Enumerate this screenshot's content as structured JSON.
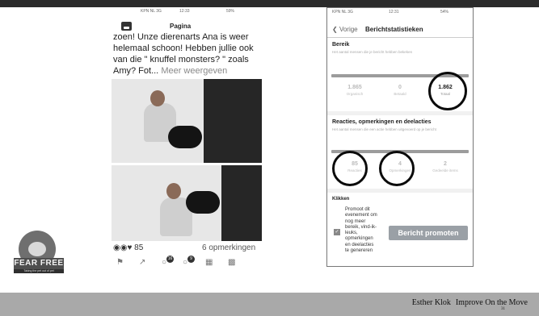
{
  "left_screen": {
    "status": {
      "carrier": "KPN NL 3G",
      "time": "12:33",
      "battery": "59%"
    },
    "page_label": "Pagina",
    "post_text": "zoen! Unze dierenarts Ana is weer helemaal schoon! Hebben jullie ook van die \" knuffel monsters? \" zoals Amy? Fot...",
    "more_link": "Meer weergeven",
    "reactions_count": "85",
    "comments_label": "6 opmerkingen",
    "toolbar": {
      "badge1": "16",
      "badge2": "9"
    }
  },
  "right_screen": {
    "status": {
      "carrier": "KPN NL 3G",
      "time": "12:31",
      "battery": "54%"
    },
    "back_label": "Vorige",
    "title": "Berichtstatistieken",
    "reach": {
      "title": "Bereik",
      "subtitle": "Het aantal mensen die je bericht hebben bekeken",
      "stats": [
        {
          "value": "1.865",
          "label": "Organisch"
        },
        {
          "value": "0",
          "label": "Betaald"
        },
        {
          "value": "1.862",
          "label": "Totaal"
        }
      ]
    },
    "engagement": {
      "title": "Reacties, opmerkingen en deelacties",
      "subtitle": "Het aantal mensen die een actie hebben uitgevoerd op je bericht",
      "stats": [
        {
          "value": "85",
          "label": "Reacties"
        },
        {
          "value": "4",
          "label": "Opmerkingen"
        },
        {
          "value": "2",
          "label": "Gedeelde items"
        }
      ]
    },
    "clicks_title": "Klikken",
    "promo_text": "Promoot dit evenement om nog meer bereik, vind-ik-leuks, opmerkingen en deelacties te genereren",
    "promo_button": "Bericht promoten"
  },
  "logo": {
    "text": "FEAR FREE",
    "tagline": "Taking the pet out of pet"
  },
  "footer": {
    "author": "Esther Klok",
    "title": "Improve On the Move",
    "slide_number": "31"
  }
}
